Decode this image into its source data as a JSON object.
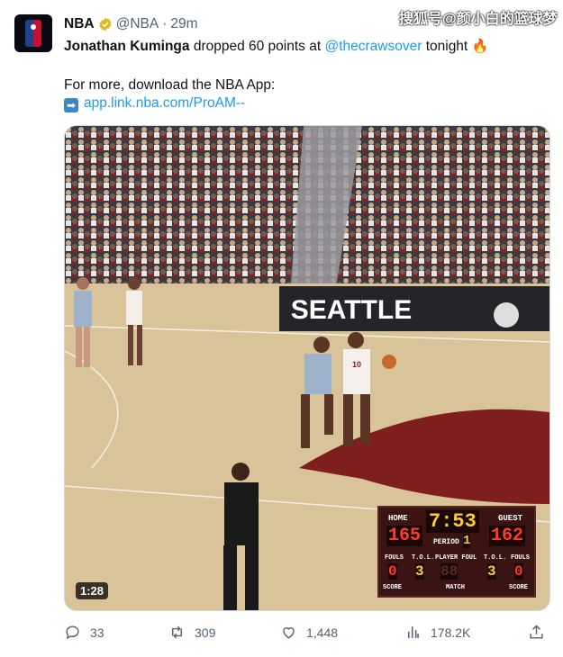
{
  "watermark": "搜狐号@颜小白的篮球梦",
  "tweet": {
    "author_name": "NBA",
    "handle": "@NBA",
    "dot": "·",
    "time": "29m",
    "text_bold": "Jonathan Kuminga",
    "text_mid": " dropped 60 points at ",
    "mention": "@thecrawsover",
    "text_end": " tonight ",
    "fire": "🔥",
    "line2": "For more, download the NBA App:",
    "arrow": "➡",
    "link": "app.link.nba.com/ProAM--"
  },
  "media": {
    "duration": "1:28",
    "banner": "SEATTLE",
    "jersey": "10"
  },
  "scoreboard": {
    "home_label": "HOME",
    "guest_label": "GUEST",
    "clock": "7:53",
    "home_score": "165",
    "guest_score": "162",
    "period_label": "PERIOD",
    "period": "1",
    "fouls_label": "FOULS",
    "tol_label": "T.O.L.",
    "player_foul_label": "PLAYER FOUL",
    "home_fouls": "0",
    "home_tol": "3",
    "player_foul": "88",
    "guest_tol": "3",
    "guest_fouls": "0",
    "score_label": "SCORE",
    "match_label": "MATCH"
  },
  "actions": {
    "replies": "33",
    "retweets": "309",
    "likes": "1,448",
    "views": "178.2K"
  },
  "colors": {
    "link": "#1d9bf0",
    "muted": "#536471",
    "verified": "#e2b719"
  }
}
